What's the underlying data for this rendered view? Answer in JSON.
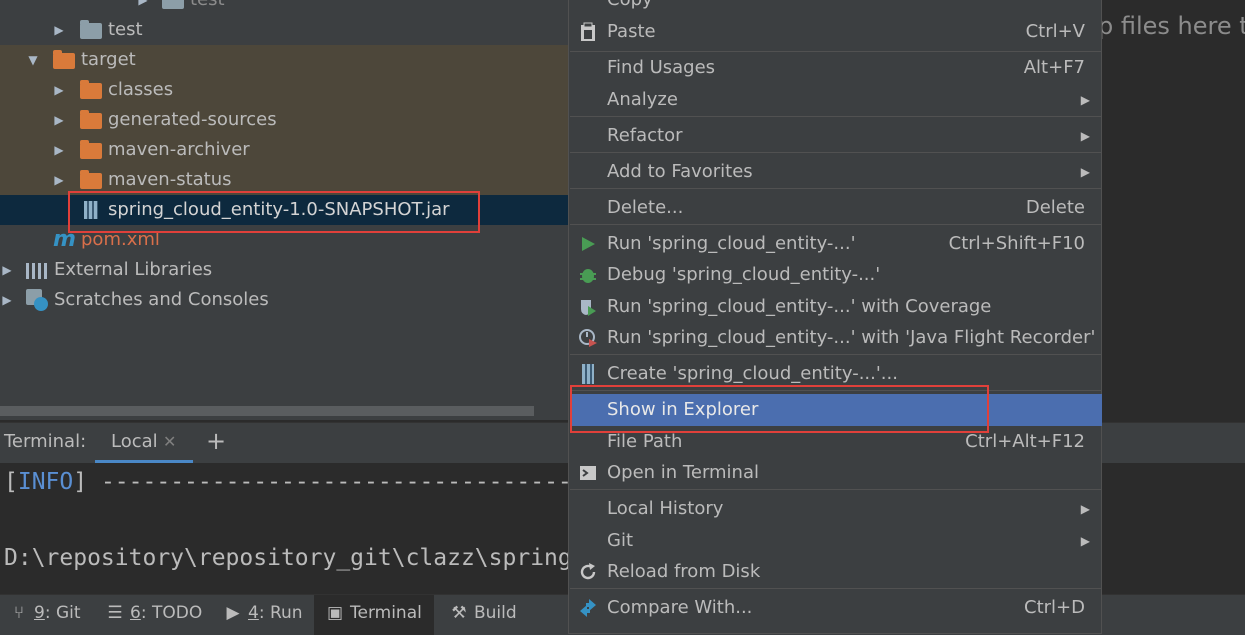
{
  "project_tree": {
    "rows": [
      {
        "label": "test"
      },
      {
        "label": "test"
      },
      {
        "label": "target"
      },
      {
        "label": "classes"
      },
      {
        "label": "generated-sources"
      },
      {
        "label": "maven-archiver"
      },
      {
        "label": "maven-status"
      },
      {
        "label": "spring_cloud_entity-1.0-SNAPSHOT.jar"
      },
      {
        "label": "pom.xml"
      },
      {
        "label": "External Libraries"
      },
      {
        "label": "Scratches and Consoles"
      }
    ]
  },
  "editor": {
    "drop_hint": "p files here to"
  },
  "context_menu": {
    "items": [
      {
        "label": "Copy",
        "shortcut": ""
      },
      {
        "label": "Paste",
        "shortcut": "Ctrl+V"
      },
      {
        "label": "Find Usages",
        "shortcut": "Alt+F7"
      },
      {
        "label": "Analyze",
        "shortcut": ""
      },
      {
        "label": "Refactor",
        "shortcut": ""
      },
      {
        "label": "Add to Favorites",
        "shortcut": ""
      },
      {
        "label": "Delete...",
        "shortcut": "Delete"
      },
      {
        "label": "Run 'spring_cloud_entity-...'",
        "shortcut": "Ctrl+Shift+F10"
      },
      {
        "label": "Debug 'spring_cloud_entity-...'",
        "shortcut": ""
      },
      {
        "label": "Run 'spring_cloud_entity-...' with Coverage",
        "shortcut": ""
      },
      {
        "label": "Run 'spring_cloud_entity-...' with 'Java Flight Recorder'",
        "shortcut": ""
      },
      {
        "label": "Create 'spring_cloud_entity-...'...",
        "shortcut": ""
      },
      {
        "label": "Show in Explorer",
        "shortcut": ""
      },
      {
        "label": "File Path",
        "shortcut": "Ctrl+Alt+F12"
      },
      {
        "label": "Open in Terminal",
        "shortcut": ""
      },
      {
        "label": "Local History",
        "shortcut": ""
      },
      {
        "label": "Git",
        "shortcut": ""
      },
      {
        "label": "Reload from Disk",
        "shortcut": ""
      },
      {
        "label": "Compare With...",
        "shortcut": "Ctrl+D"
      }
    ]
  },
  "terminal": {
    "label": "Terminal:",
    "tab": "Local",
    "lines": [
      {
        "tag": "INFO",
        "text": " -----------------------------------------------"
      },
      {
        "text": "D:\\repository\\repository_git\\clazz\\spring_"
      }
    ]
  },
  "bottom_tabs": [
    {
      "key": "9",
      "label": ": Git"
    },
    {
      "key": "6",
      "label": ": TODO"
    },
    {
      "key": "4",
      "label": ": Run"
    },
    {
      "label": "Terminal"
    },
    {
      "label": "Build"
    }
  ],
  "colors": {
    "selection": "#4b6eaf",
    "highlight_box": "#e0403a",
    "folder_orange": "#d97a3a"
  }
}
